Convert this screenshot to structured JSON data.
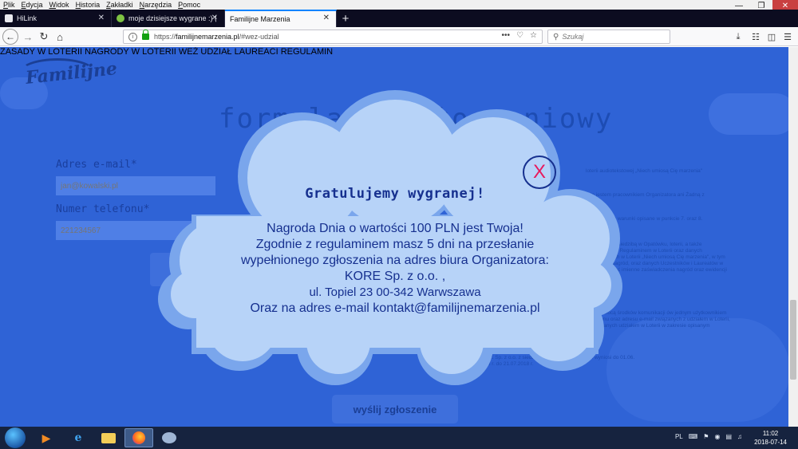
{
  "menubar": [
    "Plik",
    "Edycja",
    "Widok",
    "Historia",
    "Zakładki",
    "Narzędzia",
    "Pomoc"
  ],
  "tabs": [
    {
      "title": "HiLink"
    },
    {
      "title": "moje dzisiejsze wygrane :) (Stro"
    },
    {
      "title": "Familijne Marzenia"
    }
  ],
  "navbar": {
    "url_prefix": "https://",
    "url_host": "familijnemarzenia.pl",
    "url_path": "/#wez-udzial",
    "search_placeholder": "Szukaj",
    "more_dots": "•••"
  },
  "site": {
    "logo_text": "Familijne",
    "nav": [
      "ZASADY W LOTERII",
      "NAGRODY W LOTERII",
      "WEŹ UDZIAŁ",
      "LAUREACI",
      "REGULAMIN"
    ],
    "form_title": "formularz zgłoszeniowy",
    "email_label": "Adres e-mail*",
    "email_placeholder": "jan@kowalski.pl",
    "phone_label": "Numer telefonu*",
    "phone_placeholder": "221234567",
    "submit_label": "wyślij zgłoszenie",
    "consent": [
      "loterii audiotekstowej „Niech umiosą Cię marzenia\"",
      "ie jestem pracownikiem Organizatora ani Żadną z",
      "spełniam warunki opisane w punkcie 7. oraz 8.",
      "Sp. z o.o. z siedzibą w Opatówku, loterii, a także określonych Regulaminem w Loterii oraz danych niezbędnych w Loterii „Niech umiosą Cię marzenia\", w tym wydania Nagród, oraz danych Uczestników i Laureatów w moglii wydać imienne zaświadczenia nagród oraz ewidencji",
      "za pomocą środków komunikacji ów jednym użytkownikiem telefonu oraz adresu e-mail związanych z udziałem w Loterii, związanych udziałem w Loterii w zakresie opisanym",
      "KORE Sp. z o.o. z siedzibą w Warszawie, rodzaju wyniosi do 01.06. 2018 r. do 21.07.2018 r."
    ]
  },
  "popup": {
    "title": "Gratulujemy wygranej!",
    "lines": [
      "Nagroda Dnia o wartości 100 PLN jest Twoja!",
      "Zgodnie z regulaminem masz 5 dni na przesłanie",
      "wypełnionego zgłoszenia na adres biura Organizatora:",
      "KORE Sp. z o.o. ,",
      "ul. Topiel 23 00-342 Warwszawa",
      "Oraz na adres e-mail kontakt@familijnemarzenia.pl"
    ],
    "close_label": "X"
  },
  "taskbar": {
    "language": "PL",
    "time": "11:02",
    "date": "2018-07-14"
  },
  "colors": {
    "page_bg": "#2f63d6",
    "cloud_fill": "#b7d3f8",
    "cloud_outline": "#7aa6ec",
    "text_dark": "#16308f",
    "close_accent": "#e8195c"
  }
}
